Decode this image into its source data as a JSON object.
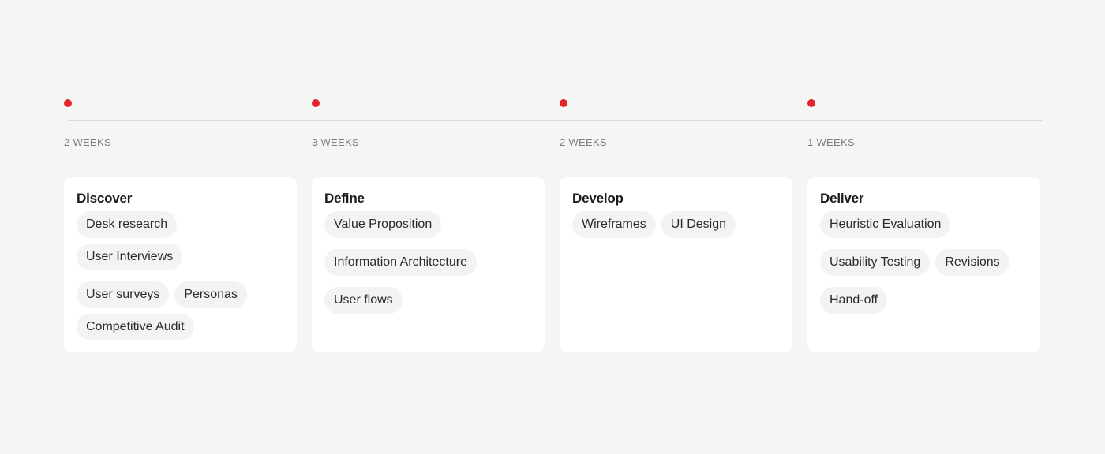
{
  "accent_color": "#e3262b",
  "phases": [
    {
      "duration": "2 WEEKS",
      "title": "Discover",
      "tags": [
        "Desk research",
        "User Interviews",
        "User surveys",
        "Personas",
        "Competitive Audit"
      ]
    },
    {
      "duration": "3 WEEKS",
      "title": "Define",
      "tags": [
        "Value Proposition",
        "Information Architecture",
        "User flows"
      ]
    },
    {
      "duration": "2 WEEKS",
      "title": "Develop",
      "tags": [
        "Wireframes",
        "UI Design"
      ]
    },
    {
      "duration": "1 WEEKS",
      "title": "Deliver",
      "tags": [
        "Heuristic Evaluation",
        "Usability Testing",
        "Revisions",
        "Hand-off"
      ]
    }
  ]
}
